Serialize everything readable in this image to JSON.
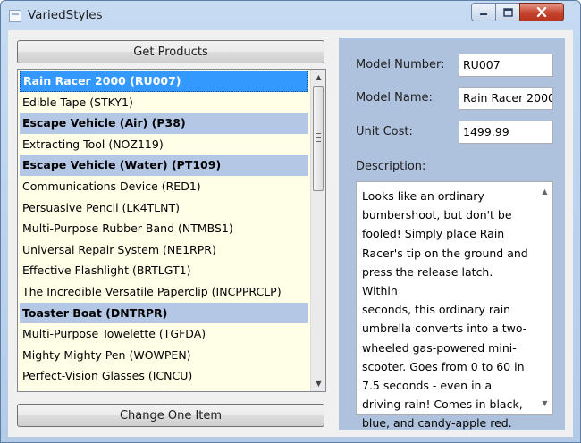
{
  "window": {
    "title": "VariedStyles"
  },
  "left": {
    "get_products_label": "Get Products",
    "change_item_label": "Change One Item",
    "products": [
      {
        "label": "Rain Racer 2000 (RU007)",
        "featured": true,
        "selected": true
      },
      {
        "label": "Edible Tape (STKY1)",
        "featured": false,
        "selected": false
      },
      {
        "label": "Escape Vehicle (Air) (P38)",
        "featured": true,
        "selected": false
      },
      {
        "label": "Extracting Tool (NOZ119)",
        "featured": false,
        "selected": false
      },
      {
        "label": "Escape Vehicle (Water) (PT109)",
        "featured": true,
        "selected": false
      },
      {
        "label": "Communications Device (RED1)",
        "featured": false,
        "selected": false
      },
      {
        "label": "Persuasive Pencil (LK4TLNT)",
        "featured": false,
        "selected": false
      },
      {
        "label": "Multi-Purpose Rubber Band (NTMBS1)",
        "featured": false,
        "selected": false
      },
      {
        "label": "Universal Repair System (NE1RPR)",
        "featured": false,
        "selected": false
      },
      {
        "label": "Effective Flashlight (BRTLGT1)",
        "featured": false,
        "selected": false
      },
      {
        "label": "The Incredible Versatile Paperclip (INCPPRCLP)",
        "featured": false,
        "selected": false
      },
      {
        "label": "Toaster Boat (DNTRPR)",
        "featured": true,
        "selected": false
      },
      {
        "label": "Multi-Purpose Towelette (TGFDA)",
        "featured": false,
        "selected": false
      },
      {
        "label": "Mighty Mighty Pen (WOWPEN)",
        "featured": false,
        "selected": false
      },
      {
        "label": "Perfect-Vision Glasses (ICNCU)",
        "featured": false,
        "selected": false
      }
    ]
  },
  "details": {
    "model_number_label": "Model Number:",
    "model_number": "RU007",
    "model_name_label": "Model Name:",
    "model_name": "Rain Racer 2000",
    "unit_cost_label": "Unit Cost:",
    "unit_cost": "1499.99",
    "description_label": "Description:",
    "description_lines": [
      "Looks like an ordinary",
      "bumbershoot, but don't be",
      "fooled! Simply place Rain",
      "Racer's tip on the ground and",
      "press the release latch. Within",
      "seconds, this ordinary rain",
      "umbrella converts into a two-",
      "wheeled gas-powered mini-",
      "scooter. Goes from 0 to 60 in",
      "7.5 seconds - even in a",
      "driving rain! Comes in black,",
      "blue, and candy-apple red."
    ]
  },
  "colors": {
    "selection": "#3399ff",
    "featured_row": "#b4c8e6",
    "list_background": "#ffffe8",
    "details_panel": "#afc2dd"
  },
  "icons": {
    "app": "window-icon",
    "minimize": "minimize-icon",
    "maximize": "maximize-icon",
    "close": "close-icon"
  }
}
